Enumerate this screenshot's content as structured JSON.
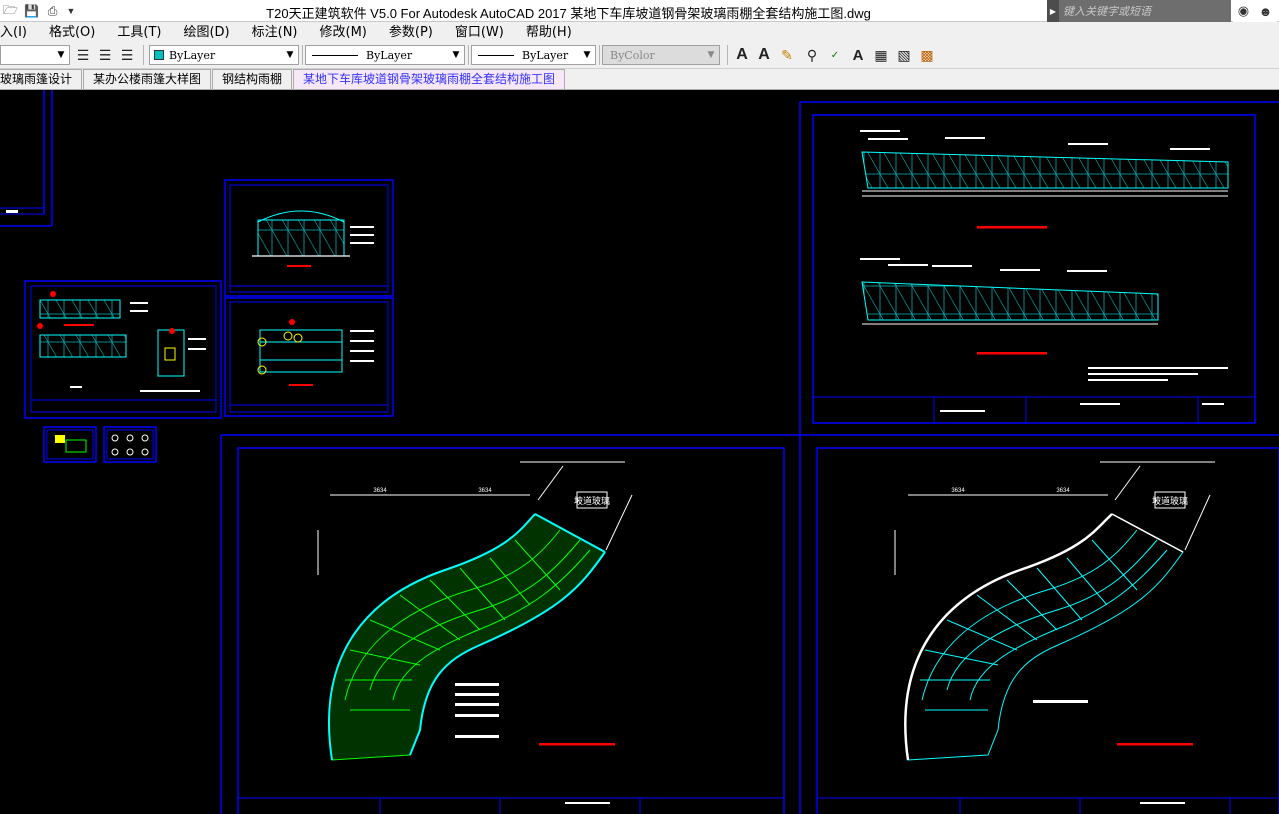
{
  "titlebar": {
    "title": "T20天正建筑软件 V5.0 For Autodesk AutoCAD 2017     某地下车库坡道钢骨架玻璃雨棚全套结构施工图.dwg",
    "search_placeholder": "键入关键字或短语"
  },
  "menu": [
    {
      "label": "入(I)"
    },
    {
      "label": "格式(O)"
    },
    {
      "label": "工具(T)"
    },
    {
      "label": "绘图(D)"
    },
    {
      "label": "标注(N)"
    },
    {
      "label": "修改(M)"
    },
    {
      "label": "参数(P)"
    },
    {
      "label": "窗口(W)"
    },
    {
      "label": "帮助(H)"
    }
  ],
  "toolbar": {
    "color_value": "ByLayer",
    "linetype_value": "ByLayer",
    "lineweight_value": "ByLayer",
    "plotstyle_value": "ByColor",
    "color_swatch": "#00c0c0"
  },
  "tabs": [
    {
      "label": "玻璃雨篷设计",
      "active": false
    },
    {
      "label": "某办公楼雨篷大样图",
      "active": false
    },
    {
      "label": "钢结构雨棚",
      "active": false
    },
    {
      "label": "某地下车库坡道钢骨架玻璃雨棚全套结构施工图",
      "active": true
    }
  ],
  "drawing": {
    "label_a": "坡道玻璃",
    "label_b": "坡道玻璃",
    "dim_a1": "3634",
    "dim_a2": "3634",
    "dim_b1": "3634",
    "dim_b2": "3634",
    "frame_color": "#0000ff",
    "steel_color": "#00ffff",
    "glass_color": "#00ff00",
    "accent_color": "#ff0000"
  }
}
